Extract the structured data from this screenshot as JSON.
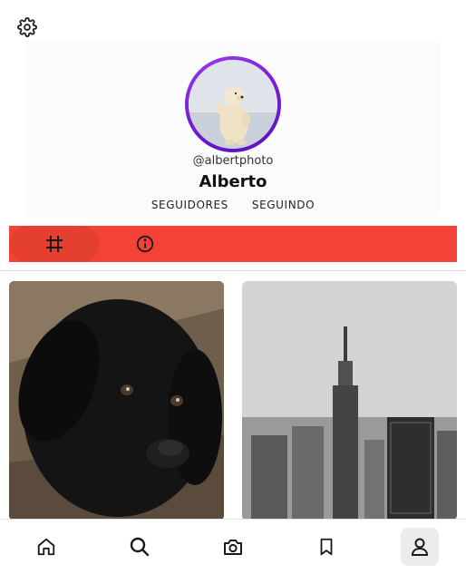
{
  "profile": {
    "handle": "@albertphoto",
    "name": "Alberto",
    "followers_label": "SEGUIDORES",
    "following_label": "SEGUINDO"
  },
  "tabs": [
    {
      "icon": "grid-icon",
      "active": true
    },
    {
      "icon": "info-icon",
      "active": false
    }
  ],
  "posts": [
    {
      "subject": "black-puppy-photo"
    },
    {
      "subject": "city-skyline-photo"
    }
  ],
  "bottom_nav": [
    {
      "icon": "home-icon"
    },
    {
      "icon": "search-icon"
    },
    {
      "icon": "camera-icon"
    },
    {
      "icon": "bookmark-icon"
    },
    {
      "icon": "profile-icon",
      "active": true
    }
  ],
  "colors": {
    "accent": "#f44336",
    "avatar_ring": "#7a1fd6"
  }
}
